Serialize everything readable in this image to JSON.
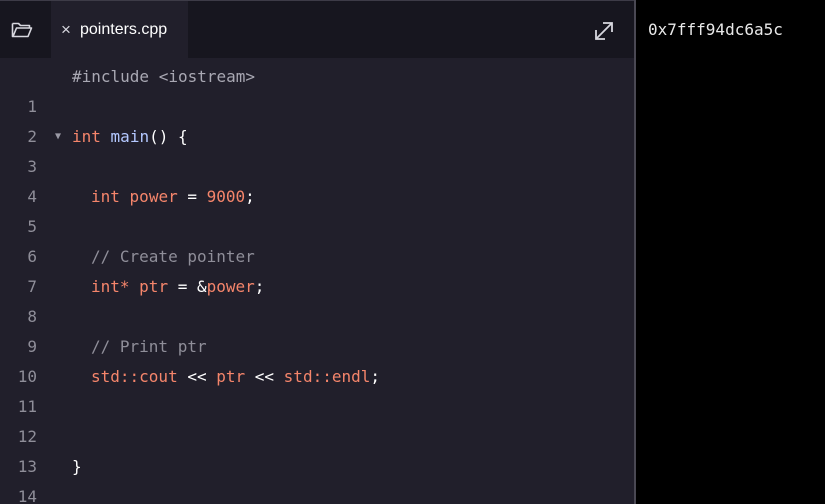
{
  "tab": {
    "close_icon": "×",
    "filename": "pointers.cpp"
  },
  "icons": {
    "folder": "folder-open-icon",
    "expand": "expand-icon",
    "fold": "fold-arrow-icon"
  },
  "code": {
    "line_numbers": [
      "1",
      "2",
      "3",
      "4",
      "5",
      "6",
      "7",
      "8",
      "9",
      "10",
      "11",
      "12",
      "13",
      "14"
    ],
    "fold_marker": "▼",
    "l1": "#include <iostream>",
    "l3": {
      "kw": "int",
      "fn": "main",
      "rest": "() {"
    },
    "l5": {
      "kw": "int",
      "var": "power",
      "eq": " = ",
      "num": "9000",
      "end": ";"
    },
    "l7": "// Create pointer",
    "l8": {
      "kw": "int*",
      "var": "ptr",
      "eq": " = &",
      "ref": "power",
      "end": ";"
    },
    "l10": "// Print ptr",
    "l11": {
      "std1": "std::cout",
      "op1": " << ",
      "var": "ptr",
      "op2": " << ",
      "std2": "std::endl",
      "end": ";"
    },
    "l14": "}"
  },
  "output": {
    "text": "0x7fff94dc6a5c"
  },
  "colors": {
    "editor_bg": "#211f2b",
    "topbar_bg": "#17161f",
    "keyword": "#f5856b",
    "function": "#b4c8ff",
    "comment": "#8f8e99",
    "output_bg": "#000000"
  }
}
